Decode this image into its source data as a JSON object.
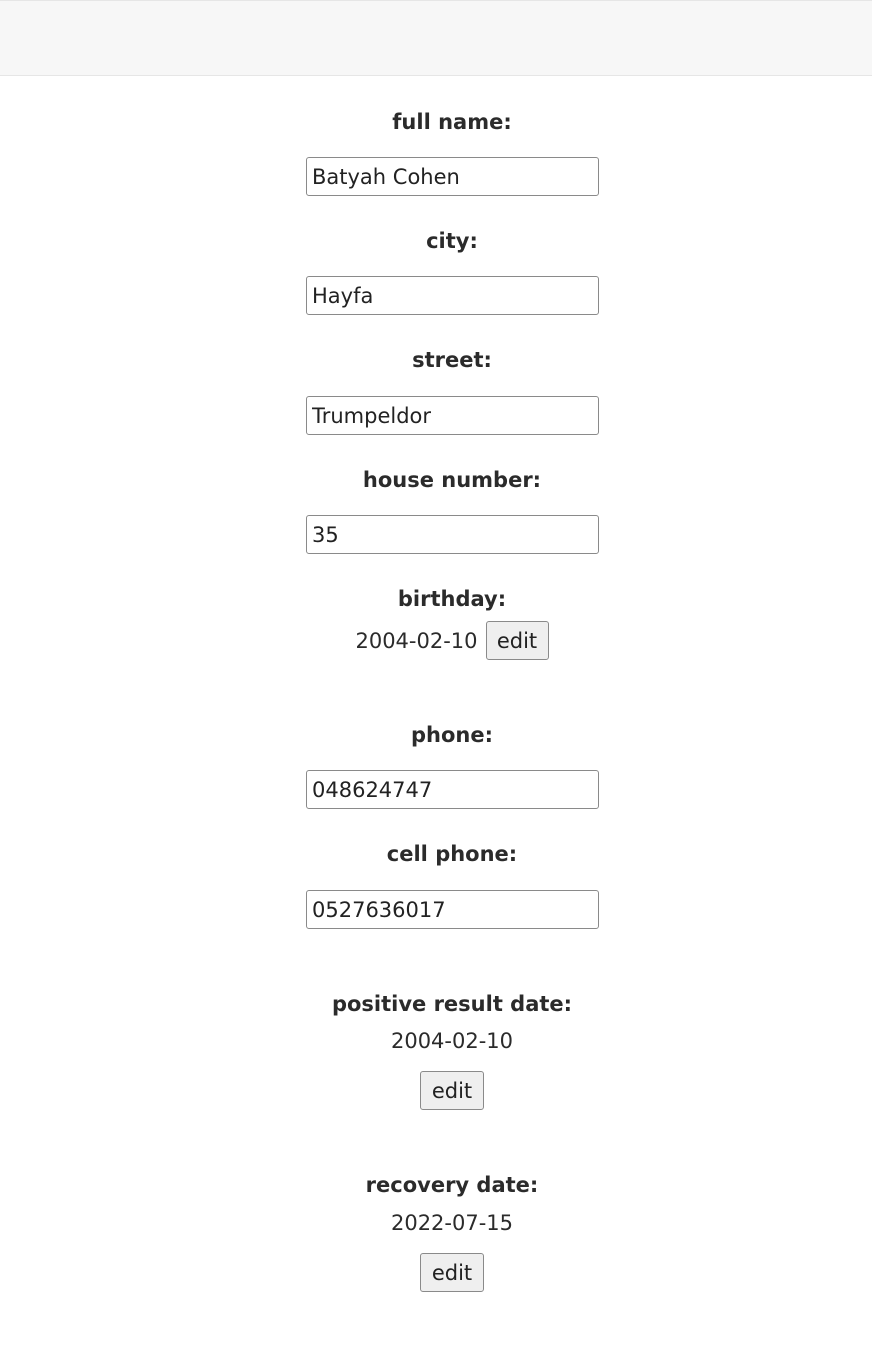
{
  "form": {
    "full_name": {
      "label": "full name:",
      "value": "Batyah Cohen"
    },
    "city": {
      "label": "city:",
      "value": "Hayfa"
    },
    "street": {
      "label": "street:",
      "value": "Trumpeldor"
    },
    "house_number": {
      "label": "house number:",
      "value": "35"
    },
    "birthday": {
      "label": "birthday:",
      "value": "2004-02-10",
      "edit_label": "edit"
    },
    "phone": {
      "label": "phone:",
      "value": "048624747"
    },
    "cell_phone": {
      "label": "cell phone:",
      "value": "0527636017"
    },
    "positive_result_date": {
      "label": "positive result date:",
      "value": "2004-02-10",
      "edit_label": "edit"
    },
    "recovery_date": {
      "label": "recovery date:",
      "value": "2022-07-15",
      "edit_label": "edit"
    }
  }
}
